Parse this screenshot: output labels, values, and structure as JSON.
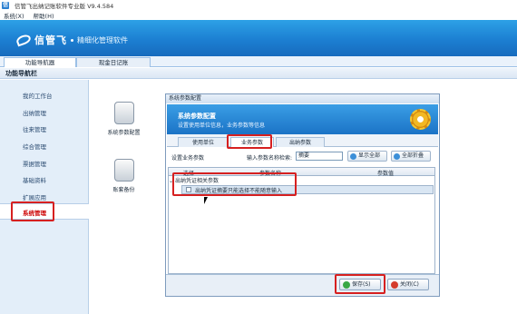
{
  "app": {
    "title": "信管飞出纳记账软件专业版 V9.4.584",
    "icon_letter": "信"
  },
  "menu": [
    "系统(X)",
    "帮助(H)"
  ],
  "brand": {
    "name": "信管飞",
    "tagline": "精细化管理软件"
  },
  "tabs": [
    "功能导航器",
    "现金日记账"
  ],
  "nav_header": "功能导航栏",
  "sidebar": {
    "items": [
      "我的工作台",
      "出纳管理",
      "往来管理",
      "综合管理",
      "票据管理",
      "基础资料",
      "扩展应用",
      "系统管理"
    ],
    "selected": "系统管理"
  },
  "tools": [
    {
      "label": "系统参数配置",
      "icon": "database-settings-icon"
    },
    {
      "label": "账套备份",
      "icon": "backup-icon"
    }
  ],
  "dialog": {
    "title": "系统参数配置",
    "header_title": "系统参数配置",
    "header_sub": "设置使用单位信息，业务参数等信息",
    "tabs": [
      "使用单位",
      "业务参数",
      "出纳参数"
    ],
    "active_tab": "业务参数",
    "row_label": "设置业务参数",
    "search_label": "输入参数名称检索:",
    "search_value": "摘要",
    "btn_expand": "显示全部",
    "btn_collapse": "全部折叠",
    "grid_headers": [
      "选择",
      "参数名称",
      "参数值"
    ],
    "group": "出纳凭证相关参数",
    "row": "出纳凭证摘要只能选择不能随意输入",
    "save": "保存(S)",
    "close": "关闭(C)"
  },
  "colors": {
    "banner": "#1c7fd2",
    "highlight_red": "#d62020",
    "gear": "#f2b824"
  }
}
